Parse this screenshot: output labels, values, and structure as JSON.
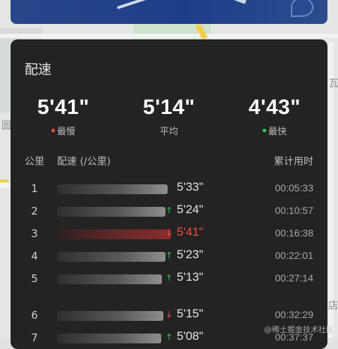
{
  "card": {
    "title": "配速"
  },
  "stats": {
    "slowest": {
      "value": "5'41\"",
      "label": "最慢",
      "dot_color": "#ff4a3d"
    },
    "average": {
      "value": "5'14\"",
      "label": "平均"
    },
    "fastest": {
      "value": "4'43\"",
      "label": "最快",
      "dot_color": "#35c85a"
    }
  },
  "table": {
    "headers": {
      "km": "公里",
      "pace": "配速 (/公里)",
      "cumulative": "累计用时"
    },
    "rows": [
      {
        "km": "1",
        "pace": "5'33\"",
        "cumulative": "00:05:33",
        "trend": "",
        "bar_fraction": 0.96
      },
      {
        "km": "2",
        "pace": "5'24\"",
        "cumulative": "00:10:57",
        "trend": "up",
        "bar_fraction": 0.94
      },
      {
        "km": "3",
        "pace": "5'41\"",
        "cumulative": "00:16:38",
        "trend": "down",
        "bar_fraction": 0.99,
        "slowest": true
      },
      {
        "km": "4",
        "pace": "5'23\"",
        "cumulative": "00:22:01",
        "trend": "up",
        "bar_fraction": 0.94
      },
      {
        "km": "5",
        "pace": "5'13\"",
        "cumulative": "00:27:14",
        "trend": "up",
        "bar_fraction": 0.91
      },
      {
        "km": "6",
        "pace": "5'15\"",
        "cumulative": "00:32:29",
        "trend": "down",
        "bar_fraction": 0.92
      },
      {
        "km": "7",
        "pace": "5'08\"",
        "cumulative": "00:37:37",
        "trend": "up",
        "bar_fraction": 0.9
      }
    ]
  },
  "map": {
    "label_left": "固",
    "label_right": "瓦",
    "label_bottom": "店"
  },
  "watermark": "@稀土掘金技术社区",
  "icons": {
    "up": "arrow-up-icon",
    "down": "arrow-down-icon"
  },
  "colors": {
    "up": "#35c85a",
    "down": "#ff4d4d",
    "card": "#232323"
  }
}
